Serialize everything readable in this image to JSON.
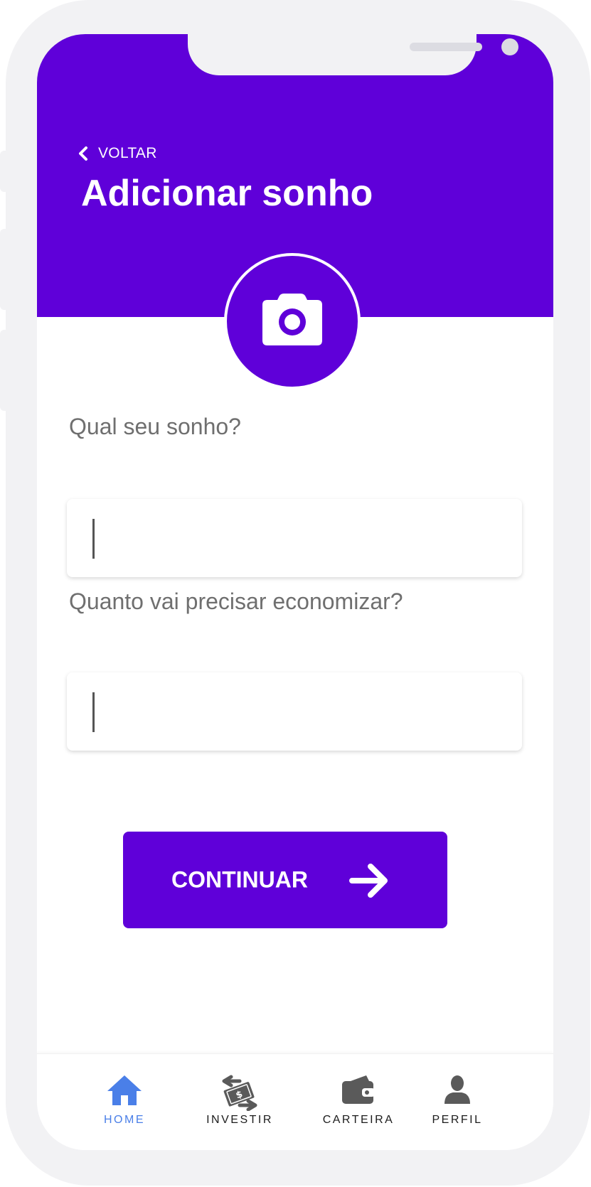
{
  "header": {
    "back_label": "VOLTAR",
    "title": "Adicionar sonho"
  },
  "photo_picker": {
    "icon": "camera-icon"
  },
  "form": {
    "dream_label": "Qual seu sonho?",
    "dream_value": "",
    "amount_label": "Quanto vai precisar economizar?",
    "amount_value": ""
  },
  "cta": {
    "label": "CONTINUAR",
    "icon": "arrow-right-icon"
  },
  "bottom_nav": {
    "items": [
      {
        "label": "HOME",
        "icon": "home-icon",
        "active": true
      },
      {
        "label": "INVESTIR",
        "icon": "money-transfer-icon",
        "active": false
      },
      {
        "label": "CARTEIRA",
        "icon": "wallet-icon",
        "active": false
      },
      {
        "label": "PERFIL",
        "icon": "person-icon",
        "active": false
      }
    ]
  },
  "colors": {
    "brand": "#5f00d9",
    "active_nav": "#4a7fe8",
    "label_gray": "#6f6f6f",
    "frame": "#f2f2f4"
  }
}
